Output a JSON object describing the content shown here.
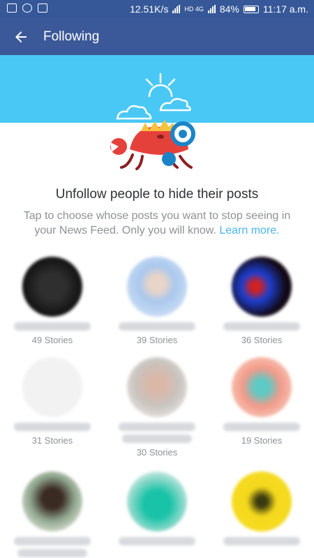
{
  "status_bar": {
    "speed": "12.51K/s",
    "network": "HD 4G",
    "battery": "84%",
    "time": "11:17 a.m."
  },
  "header": {
    "title": "Following",
    "back_icon": "arrow-left-icon"
  },
  "intro": {
    "headline": "Unfollow people to hide their posts",
    "description": "Tap to choose whose posts you want to stop seeing in your News Feed. Only you will know.",
    "learn_more": "Learn more."
  },
  "colors": {
    "header": "#3b5998",
    "status_bar": "#365898",
    "banner": "#4ac8f5",
    "link": "#4ab3f4",
    "crab": "#e5413b"
  },
  "people": [
    {
      "stories": "49 Stories"
    },
    {
      "stories": "39 Stories"
    },
    {
      "stories": "36 Stories"
    },
    {
      "stories": "31 Stories"
    },
    {
      "stories": "30 Stories"
    },
    {
      "stories": "19 Stories"
    },
    {
      "stories": ""
    },
    {
      "stories": ""
    },
    {
      "stories": ""
    }
  ]
}
